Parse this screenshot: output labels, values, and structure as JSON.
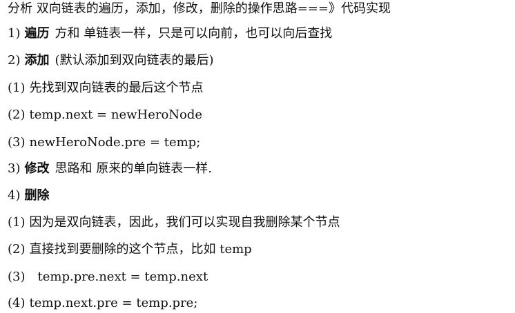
{
  "title": "分析 双向链表的遍历，添加，修改，删除的操作思路===》代码实现",
  "items": [
    {
      "num": "1)",
      "bold": "遍历",
      "text": "方和 单链表一样，只是可以向前，也可以向后查找"
    },
    {
      "num": "2)",
      "bold": "添加",
      "text": "(默认添加到双向链表的最后)"
    },
    {
      "num": "(1)",
      "text": "先找到双向链表的最后这个节点"
    },
    {
      "num": "(2)",
      "text": "temp.next = newHeroNode"
    },
    {
      "num": "(3)",
      "text": "newHeroNode.pre = temp;"
    },
    {
      "num": "3)",
      "bold": "修改",
      "text": "思路和 原来的单向链表一样."
    },
    {
      "num": "4)",
      "bold": "删除",
      "text": ""
    },
    {
      "num": "(1)",
      "text": "因为是双向链表，因此，我们可以实现自我删除某个节点"
    },
    {
      "num": "(2)",
      "text": "直接找到要删除的这个节点，比如 temp"
    },
    {
      "num": "(3)",
      "text": "temp.pre.next = temp.next"
    },
    {
      "num": "(4)",
      "text": "temp.next.pre = temp.pre;"
    }
  ]
}
